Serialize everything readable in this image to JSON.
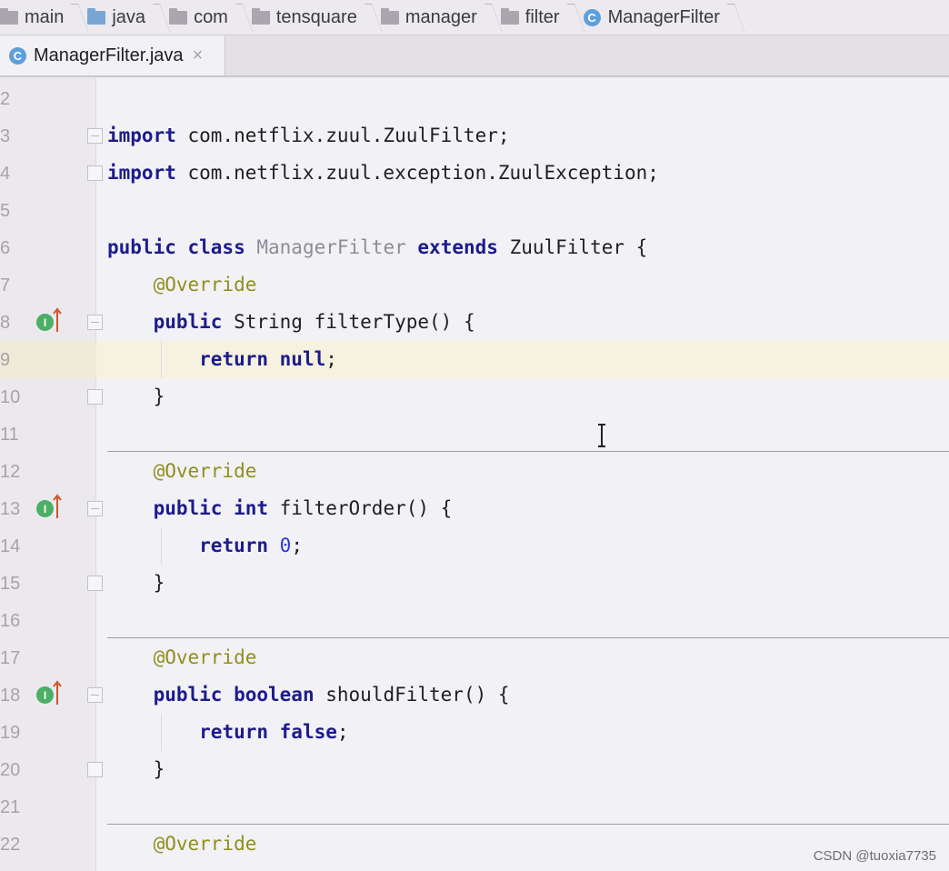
{
  "breadcrumb": {
    "items": [
      {
        "label": "main",
        "icon": "folder-icon"
      },
      {
        "label": "java",
        "icon": "source-folder-icon"
      },
      {
        "label": "com",
        "icon": "folder-icon"
      },
      {
        "label": "tensquare",
        "icon": "folder-icon"
      },
      {
        "label": "manager",
        "icon": "folder-icon"
      },
      {
        "label": "filter",
        "icon": "folder-icon"
      },
      {
        "label": "ManagerFilter",
        "icon": "class-icon"
      }
    ]
  },
  "tab": {
    "label": "ManagerFilter.java",
    "close_glyph": "×",
    "icon_letter": "C"
  },
  "editor": {
    "current_line": 9,
    "lines": [
      {
        "num": "2",
        "tokens": []
      },
      {
        "num": "3",
        "tokens": [
          {
            "t": "import",
            "c": "kw"
          },
          {
            "t": " com.netflix.zuul.ZuulFilter;"
          }
        ]
      },
      {
        "num": "4",
        "tokens": [
          {
            "t": "import",
            "c": "kw"
          },
          {
            "t": " com.netflix.zuul.exception.ZuulException;"
          }
        ]
      },
      {
        "num": "5",
        "tokens": []
      },
      {
        "num": "6",
        "tokens": [
          {
            "t": "public class",
            "c": "kw"
          },
          {
            "t": " "
          },
          {
            "t": "ManagerFilter",
            "c": "cls-gray"
          },
          {
            "t": " "
          },
          {
            "t": "extends",
            "c": "kw"
          },
          {
            "t": " ZuulFilter {"
          }
        ]
      },
      {
        "num": "7",
        "tokens": [
          {
            "t": "    "
          },
          {
            "t": "@Override",
            "c": "ann"
          }
        ]
      },
      {
        "num": "8",
        "tokens": [
          {
            "t": "    "
          },
          {
            "t": "public",
            "c": "kw"
          },
          {
            "t": " String filterType() {"
          }
        ]
      },
      {
        "num": "9",
        "tokens": [
          {
            "t": "        "
          },
          {
            "t": "return null",
            "c": "kw"
          },
          {
            "t": ";"
          }
        ]
      },
      {
        "num": "10",
        "tokens": [
          {
            "t": "    }"
          }
        ]
      },
      {
        "num": "11",
        "tokens": []
      },
      {
        "num": "12",
        "tokens": [
          {
            "t": "    "
          },
          {
            "t": "@Override",
            "c": "ann"
          }
        ]
      },
      {
        "num": "13",
        "tokens": [
          {
            "t": "    "
          },
          {
            "t": "public int",
            "c": "kw"
          },
          {
            "t": " filterOrder() {"
          }
        ]
      },
      {
        "num": "14",
        "tokens": [
          {
            "t": "        "
          },
          {
            "t": "return",
            "c": "kw"
          },
          {
            "t": " "
          },
          {
            "t": "0",
            "c": "num"
          },
          {
            "t": ";"
          }
        ]
      },
      {
        "num": "15",
        "tokens": [
          {
            "t": "    }"
          }
        ]
      },
      {
        "num": "16",
        "tokens": []
      },
      {
        "num": "17",
        "tokens": [
          {
            "t": "    "
          },
          {
            "t": "@Override",
            "c": "ann"
          }
        ]
      },
      {
        "num": "18",
        "tokens": [
          {
            "t": "    "
          },
          {
            "t": "public boolean",
            "c": "kw"
          },
          {
            "t": " shouldFilter() {"
          }
        ]
      },
      {
        "num": "19",
        "tokens": [
          {
            "t": "        "
          },
          {
            "t": "return false",
            "c": "kw"
          },
          {
            "t": ";"
          }
        ]
      },
      {
        "num": "20",
        "tokens": [
          {
            "t": "    }"
          }
        ]
      },
      {
        "num": "21",
        "tokens": []
      },
      {
        "num": "22",
        "tokens": [
          {
            "t": "    "
          },
          {
            "t": "@Override",
            "c": "ann"
          }
        ]
      }
    ],
    "implements_markers": [
      "8",
      "13",
      "18"
    ],
    "fold_open": [
      "3",
      "8",
      "13",
      "18"
    ],
    "fold_end": [
      "4",
      "10",
      "15",
      "20"
    ],
    "method_separators_after": [
      "10",
      "15",
      "20"
    ]
  },
  "colors": {
    "keyword": "#1c1c8c",
    "annotation": "#8f8f1e",
    "number": "#2a35d8",
    "current_line": "#f7f1df"
  },
  "watermark": "CSDN @tuoxia7735"
}
